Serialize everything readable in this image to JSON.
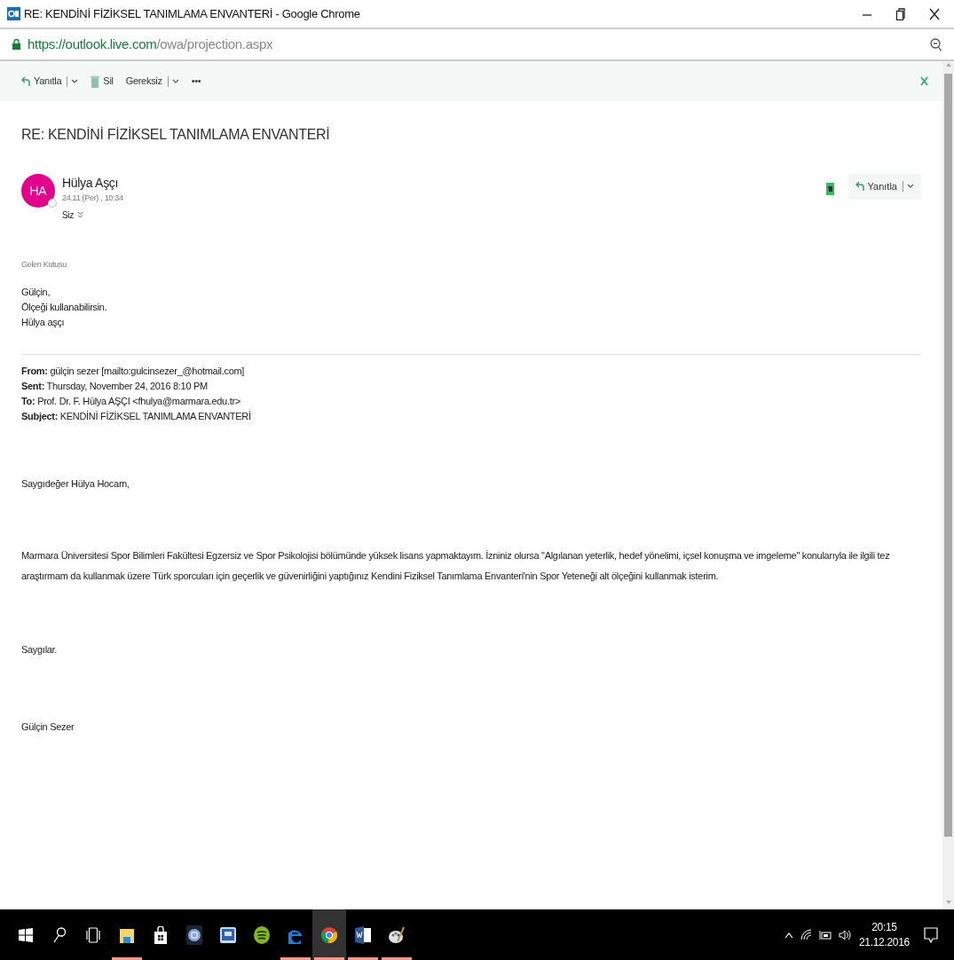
{
  "window": {
    "title": "RE: KENDİNİ FİZİKSEL TANIMLAMA ENVANTERİ - Google Chrome"
  },
  "address_bar": {
    "url_host": "https://outlook.live.com",
    "url_path": "/owa/projection.aspx"
  },
  "toolbar": {
    "items": [
      {
        "kind": "reply",
        "label": "Yanıtla",
        "dropdown": true
      },
      {
        "kind": "delete",
        "label": "Sil",
        "dropdown": false
      },
      {
        "kind": "junk",
        "label": "Gereksiz",
        "dropdown": true
      },
      {
        "kind": "more",
        "label": "•••",
        "dropdown": false
      }
    ]
  },
  "message": {
    "subject": "RE: KENDİNİ FİZİKSEL TANIMLAMA ENVANTERİ",
    "sender": {
      "initials": "HA",
      "name": "Hülya Aşçı",
      "date": "24.11 (Per) , 10:34",
      "recipient": "Siz"
    },
    "reply_button": {
      "label": "Yanıtla",
      "dropdown": true
    },
    "folder": "Gelen Kutusu",
    "reply_lines": [
      "Gülçin,",
      "Ölçeği kullanabilirsin.",
      "Hülya aşçı"
    ],
    "quoted_header": [
      {
        "label": "From:",
        "value": "gülçin sezer [mailto:gulcinsezer_@hotmail.com]"
      },
      {
        "label": "Sent:",
        "value": "Thursday, November 24, 2016 8:10 PM"
      },
      {
        "label": "To:",
        "value": "Prof. Dr. F. Hülya AŞÇI <fhulya@marmara.edu.tr>"
      },
      {
        "label": "Subject:",
        "value": "KENDİNİ FİZİKSEL TANIMLAMA ENVANTERİ"
      }
    ],
    "body": [
      "Saygıdeğer Hülya Hocam,",
      "Marmara Üniversitesi Spor Bilimleri Fakültesi Egzersiz ve Spor Psikolojisi bölümünde yüksek lisans yapmaktayım. İzniniz olursa \"Algılanan yeterlik, hedef yönelimi, içsel konuşma ve imgeleme\" konularıyla ile ilgili tez araştırmam da kullanmak üzere Türk sporcuları için geçerlik ve güvenirliğini yaptığınız Kendini Fiziksel Tanımlama Envanteri'nin Spor Yeteneği alt ölçeğini kullanmak isterim.",
      "Saygılar.",
      "Gülçin Sezer"
    ]
  },
  "taskbar": {
    "items": [
      {
        "kind": "start",
        "running": false,
        "active": false
      },
      {
        "kind": "search",
        "running": false,
        "active": false
      },
      {
        "kind": "taskview",
        "running": false,
        "active": false
      },
      {
        "kind": "explorer",
        "running": true,
        "active": false
      },
      {
        "kind": "store",
        "running": false,
        "active": false
      },
      {
        "kind": "app",
        "running": false,
        "active": false
      },
      {
        "kind": "chat",
        "running": false,
        "active": false
      },
      {
        "kind": "spotify",
        "running": false,
        "active": false
      },
      {
        "kind": "edge",
        "running": true,
        "active": false
      },
      {
        "kind": "chrome",
        "running": true,
        "active": true
      },
      {
        "kind": "word",
        "running": true,
        "active": false
      },
      {
        "kind": "paint",
        "running": true,
        "active": false
      }
    ],
    "time": "20:15",
    "date": "21.12.2016"
  }
}
